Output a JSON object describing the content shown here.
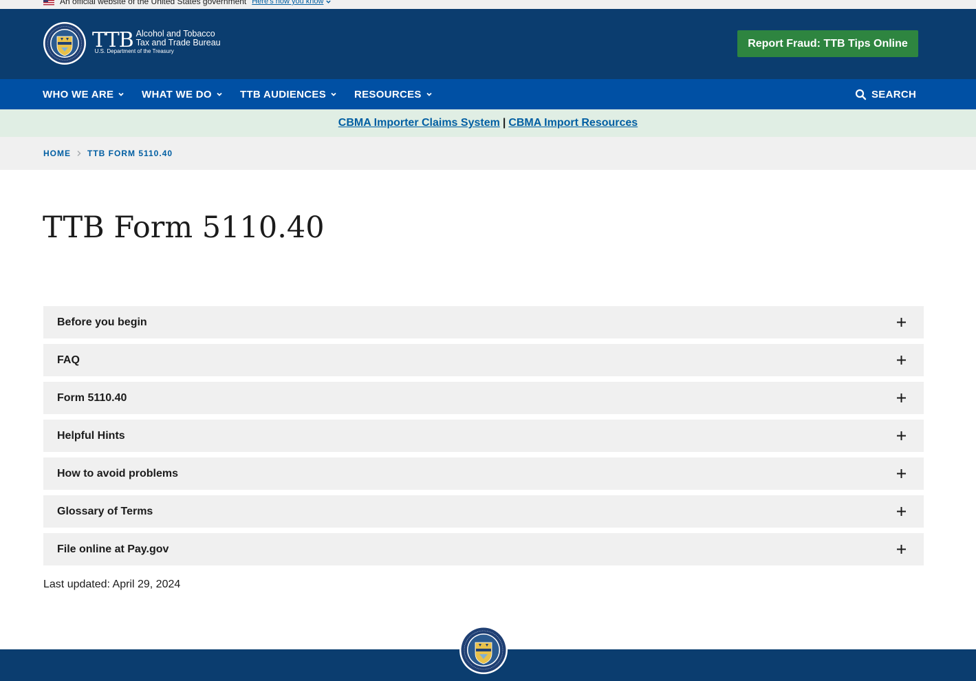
{
  "gov_banner": {
    "text": "An official website of the United States government",
    "link": "Here's how you know"
  },
  "header": {
    "logo_mark": "TTB",
    "logo_line1": "Alcohol and Tobacco",
    "logo_line2": "Tax and Trade Bureau",
    "logo_line3": "U.S. Department of the Treasury",
    "report_button": "Report Fraud: TTB Tips Online"
  },
  "nav": {
    "items": [
      {
        "label": "WHO WE ARE"
      },
      {
        "label": "WHAT WE DO"
      },
      {
        "label": "TTB AUDIENCES"
      },
      {
        "label": "RESOURCES"
      }
    ],
    "search_label": "SEARCH"
  },
  "alert": {
    "link1": "CBMA Importer Claims System",
    "separator": "|",
    "link2": "CBMA Import Resources"
  },
  "breadcrumb": {
    "home": "HOME",
    "current": "TTB FORM 5110.40"
  },
  "page": {
    "title": "TTB Form 5110.40",
    "last_updated": "Last updated: April 29, 2024"
  },
  "accordion": [
    {
      "label": "Before you begin"
    },
    {
      "label": "FAQ"
    },
    {
      "label": "Form 5110.40"
    },
    {
      "label": "Helpful Hints"
    },
    {
      "label": "How to avoid problems"
    },
    {
      "label": "Glossary of Terms"
    },
    {
      "label": "File online at Pay.gov"
    }
  ],
  "colors": {
    "header_bg": "#0b3d6f",
    "nav_bg": "#0050a4",
    "report_btn": "#2e8540",
    "alert_bg": "#e0eee4",
    "link": "#005ea2",
    "accordion_bg": "#f0f0f0"
  }
}
